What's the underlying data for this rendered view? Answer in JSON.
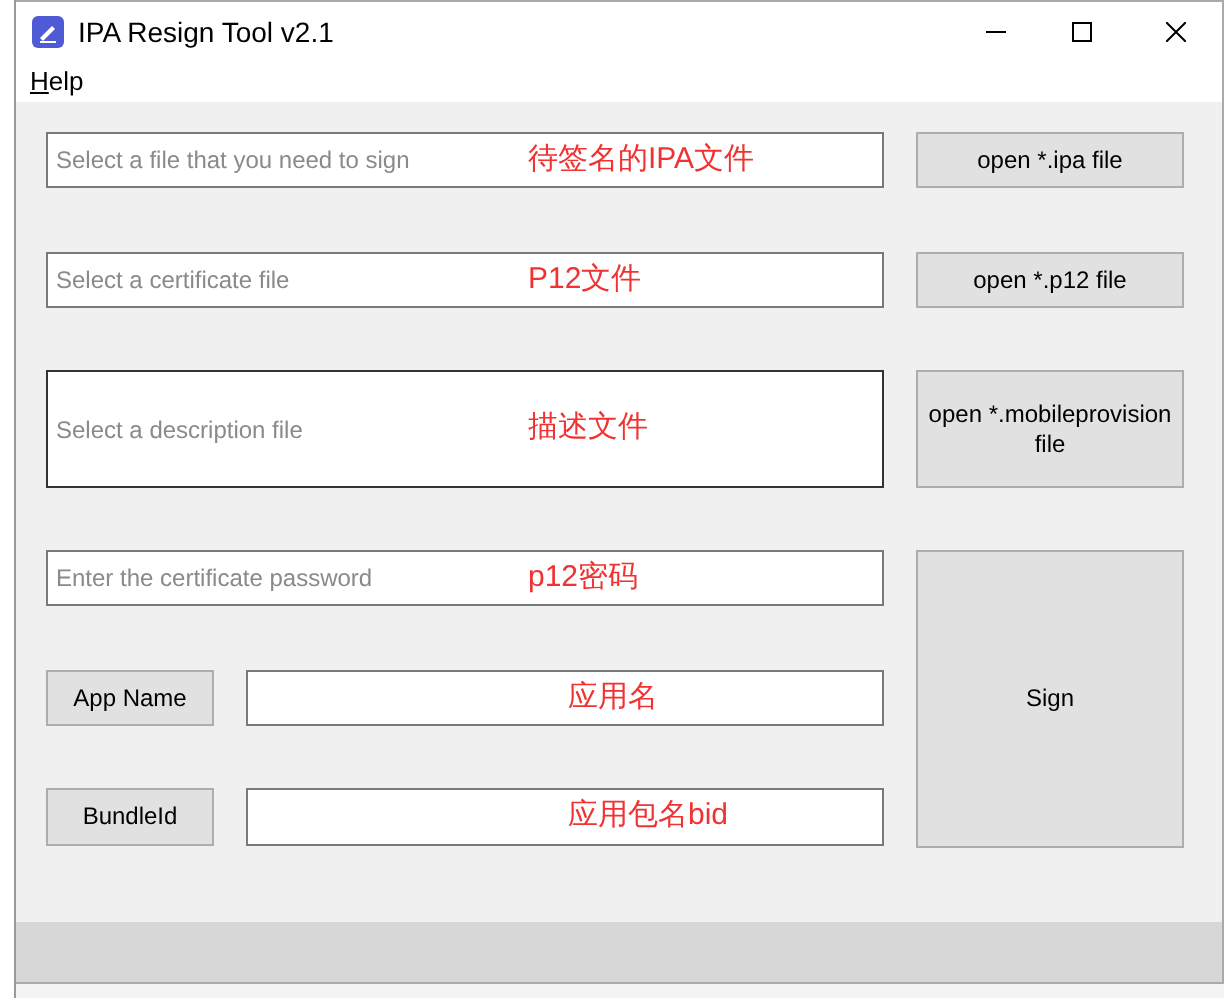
{
  "window": {
    "title": "IPA Resign Tool v2.1"
  },
  "menu": [
    {
      "label": "Help",
      "mnemonic_underlined": true
    }
  ],
  "rows": [
    {
      "kind": "file",
      "placeholder": "Select a file that you need to sign",
      "annotation": "待签名的IPA文件",
      "button": "open *.ipa file",
      "focused": false
    },
    {
      "kind": "file",
      "placeholder": "Select a certificate file",
      "annotation": "P12文件",
      "button": "open *.p12 file",
      "focused": false
    },
    {
      "kind": "file",
      "placeholder": "Select a description file",
      "annotation": "描述文件",
      "button": "open *.mobileprovision file",
      "focused": true
    },
    {
      "kind": "password",
      "placeholder": "Enter the certificate password",
      "annotation": "p12密码"
    },
    {
      "kind": "labeled",
      "label": "App Name",
      "annotation": "应用名"
    },
    {
      "kind": "labeled",
      "label": "BundleId",
      "annotation": "应用包名bid"
    }
  ],
  "sign_button": "Sign"
}
